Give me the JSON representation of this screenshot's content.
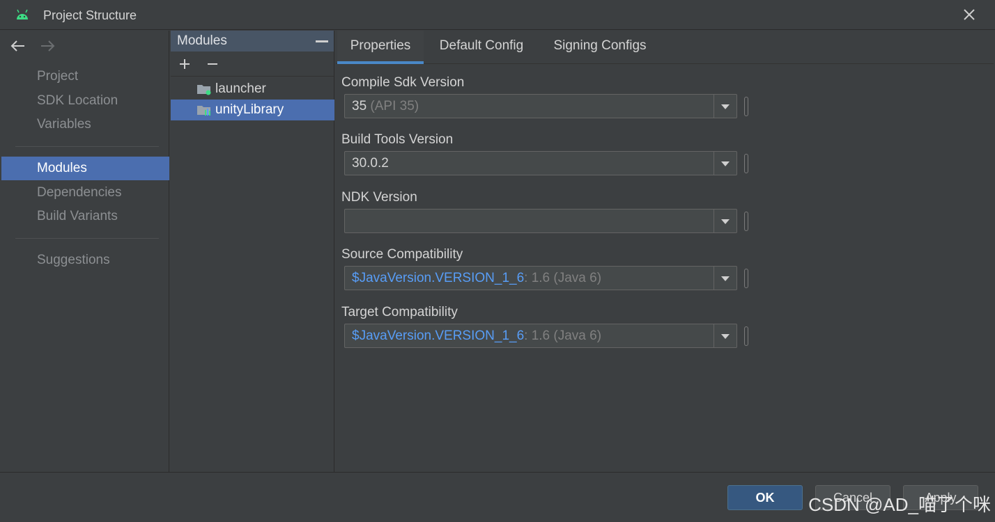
{
  "window": {
    "title": "Project Structure"
  },
  "nav": {
    "items": [
      "Project",
      "SDK Location",
      "Variables",
      "Modules",
      "Dependencies",
      "Build Variants",
      "Suggestions"
    ]
  },
  "modules_panel": {
    "header": "Modules",
    "items": [
      "launcher",
      "unityLibrary"
    ]
  },
  "tabs": [
    "Properties",
    "Default Config",
    "Signing Configs"
  ],
  "fields": {
    "compile_sdk": {
      "label": "Compile Sdk Version",
      "value": "35",
      "hint": "(API 35)"
    },
    "build_tools": {
      "label": "Build Tools Version",
      "value": "30.0.2"
    },
    "ndk": {
      "label": "NDK Version",
      "value": ""
    },
    "source_compat": {
      "label": "Source Compatibility",
      "value": "$JavaVersion.VERSION_1_6",
      "hint": ": 1.6 (Java 6)"
    },
    "target_compat": {
      "label": "Target Compatibility",
      "value": "$JavaVersion.VERSION_1_6",
      "hint": ": 1.6 (Java 6)"
    }
  },
  "buttons": {
    "ok": "OK",
    "cancel": "Cancel",
    "apply": "Apply"
  },
  "watermark": "CSDN @AD_喵了个咪",
  "colors": {
    "accent": "#4b6eaf",
    "link": "#589df6",
    "background": "#3c3f41",
    "android_green": "#3ddc84"
  }
}
